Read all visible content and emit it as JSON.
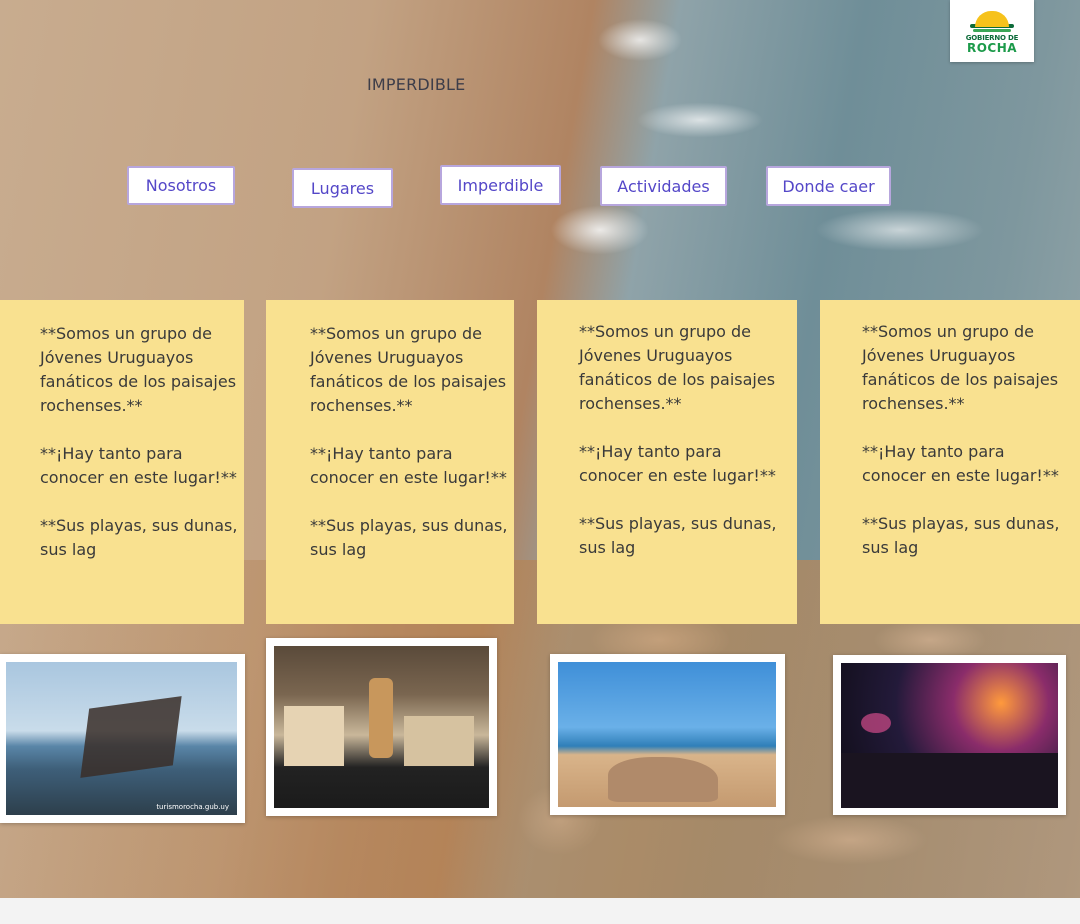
{
  "header": {
    "title": "IMPERDIBLE",
    "logo": {
      "line1": "GOBIERNO DE",
      "line2": "ROCHA"
    }
  },
  "nav": {
    "items": [
      {
        "label": "Nosotros"
      },
      {
        "label": "Lugares"
      },
      {
        "label": "Imperdible"
      },
      {
        "label": "Actividades"
      },
      {
        "label": "Donde caer"
      }
    ]
  },
  "cards": [
    {
      "p1": "**Somos un grupo de Jóvenes Uruguayos fanáticos de los paisajes rochenses.**",
      "p2": "**¡Hay tanto para conocer en este lugar!**",
      "p3": "**Sus playas, sus dunas, sus lag"
    },
    {
      "p1": "**Somos un grupo de Jóvenes Uruguayos fanáticos de los paisajes rochenses.**",
      "p2": "**¡Hay tanto para conocer en este lugar!**",
      "p3": "**Sus playas, sus dunas, sus lag"
    },
    {
      "p1": "**Somos un grupo de Jóvenes Uruguayos fanáticos de los paisajes rochenses.**",
      "p2": "**¡Hay tanto para conocer en este lugar!**",
      "p3": "**Sus playas, sus dunas, sus lag"
    },
    {
      "p1": "**Somos un grupo de Jóvenes Uruguayos fanáticos de los paisajes rochenses.**",
      "p2": "**¡Hay tanto para conocer en este lugar!**",
      "p3": "**Sus playas, sus dunas, sus lag"
    }
  ],
  "photos": [
    {
      "subject": "shipwreck-on-beach",
      "caption": "turismorocha.gub.uy"
    },
    {
      "subject": "local-products-stand"
    },
    {
      "subject": "sand-dunes-and-sea"
    },
    {
      "subject": "night-party-crowd"
    }
  ],
  "colors": {
    "card_bg": "#f9e190",
    "nav_text": "#5447c8",
    "nav_border": "#b7a6dd"
  }
}
